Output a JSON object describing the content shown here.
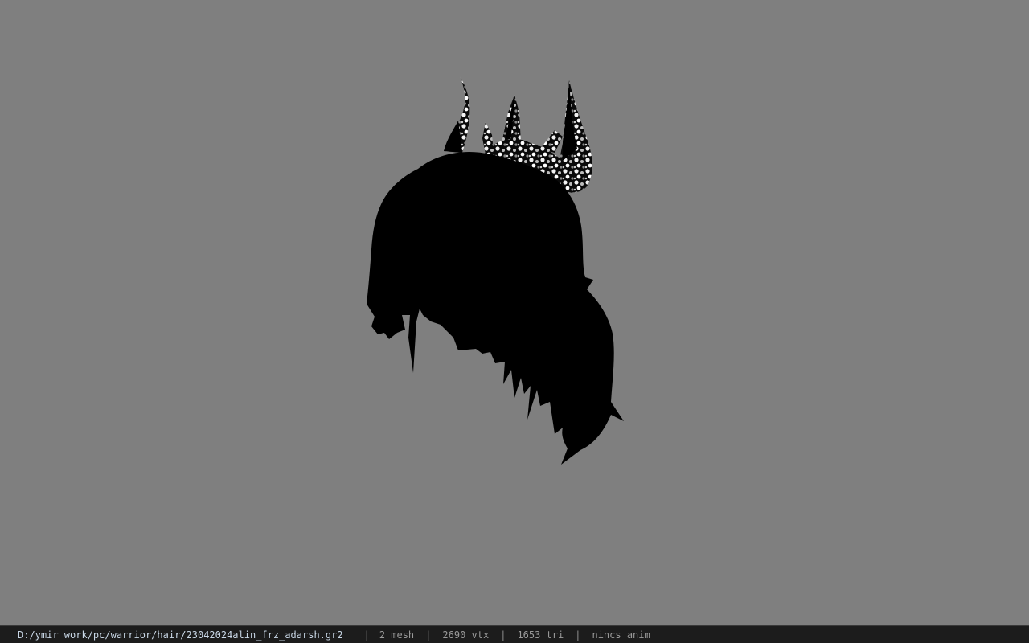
{
  "viewport": {
    "background_color": "#7f7f7f",
    "model": {
      "name": "hair-mesh",
      "silhouette_color": "#000000",
      "texture_colors": [
        "#000000",
        "#ffffff",
        "#9a9a9a"
      ]
    }
  },
  "status_bar": {
    "file_path": "D:/ymir work/pc/warrior/hair/23042024alin_frz_adarsh.gr2",
    "separator": "|",
    "mesh_count": "2 mesh",
    "vertex_count": "2690 vtx",
    "triangle_count": "1653 tri",
    "animation": "nincs anim"
  }
}
